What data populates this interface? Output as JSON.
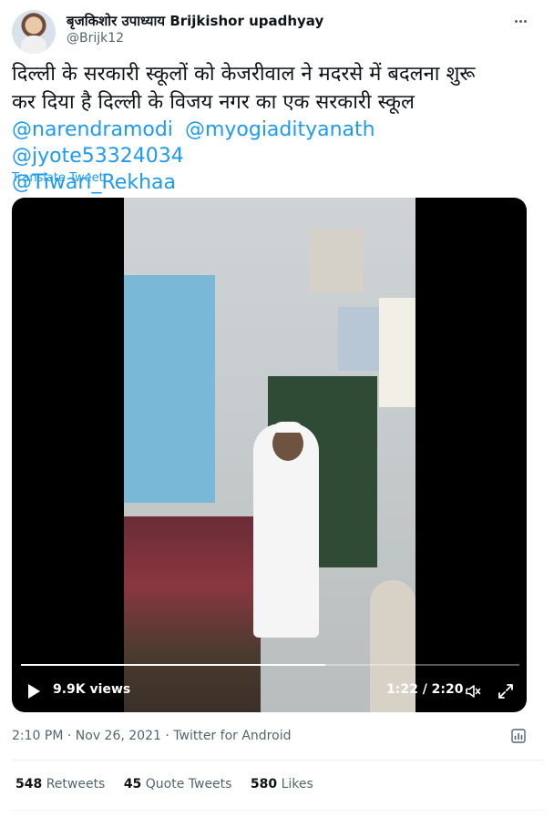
{
  "author": {
    "display_name": "बृजकिशोर उपाध्याय Brijkishor upadhyay",
    "handle": "@Brijk12"
  },
  "tweet": {
    "text_line1": "दिल्ली के सरकारी स्कूलों को केजरीवाल ने मदरसे में बदलना शुरू",
    "text_line2": "कर दिया है दिल्ली के विजय नगर का एक सरकारी स्कूल",
    "mentions": [
      "@narendramodi",
      "@myogiadityanath",
      "@jyote53324034",
      "@Tiwari_Rekhaa"
    ],
    "translate_label": "Translate Tweet"
  },
  "video": {
    "views": "9.9K views",
    "time": "1:22 / 2:20",
    "progress_fraction": 0.61
  },
  "meta": {
    "time": "2:10 PM",
    "date": "Nov 26, 2021",
    "source": "Twitter for Android",
    "separator": "·"
  },
  "stats": [
    {
      "count": "548",
      "label": "Retweets"
    },
    {
      "count": "45",
      "label": "Quote Tweets"
    },
    {
      "count": "580",
      "label": "Likes"
    }
  ],
  "colors": {
    "link": "#1d9bf0",
    "muted": "#536471",
    "text": "#0f1419"
  },
  "icons": [
    "more-icon",
    "play-icon",
    "volume-icon",
    "fullscreen-icon",
    "analytics-icon"
  ]
}
